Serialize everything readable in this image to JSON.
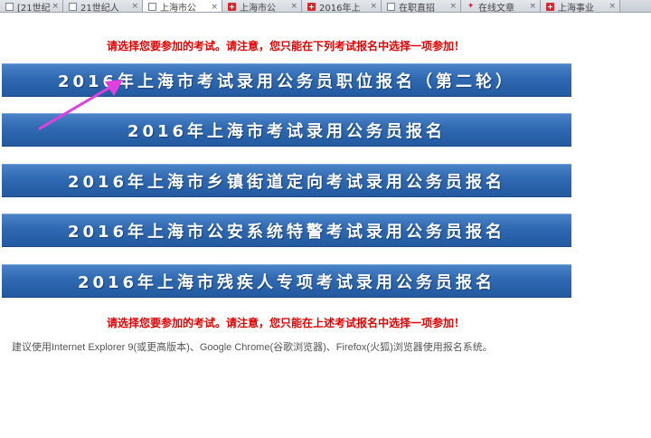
{
  "browser": {
    "tabs": [
      {
        "label": "[21世纪",
        "icon": "page-icon",
        "active": false
      },
      {
        "label": "21世纪人",
        "icon": "page-icon",
        "active": false
      },
      {
        "label": "上海市公",
        "icon": "page-icon",
        "active": true
      },
      {
        "label": "上海市公",
        "icon": "red-cross-icon",
        "active": false
      },
      {
        "label": "2016年上",
        "icon": "red-cross-icon",
        "active": false
      },
      {
        "label": "在职直招",
        "icon": "page-icon",
        "active": false
      },
      {
        "label": "在线文章",
        "icon": "star-icon",
        "active": false
      },
      {
        "label": "上海事业",
        "icon": "red-cross-icon",
        "active": false
      }
    ],
    "close_glyph": "×"
  },
  "page": {
    "notice_top": "请选择您要参加的考试。请注意，您只能在下列考试报名中选择一项参加！",
    "notice_bottom": "请选择您要参加的考试。请注意，您只能在上述考试报名中选择一项参加！",
    "exams": [
      "2016年上海市考试录用公务员职位报名（第二轮）",
      "2016年上海市考试录用公务员报名",
      "2016年上海市乡镇街道定向考试录用公务员报名",
      "2016年上海市公安系统特警考试录用公务员报名",
      "2016年上海市残疾人专项考试录用公务员报名"
    ],
    "browser_hint": "建议使用Internet Explorer 9(或更高版本)、Google Chrome(谷歌浏览器)、Firefox(火狐)浏览器使用报名系统。"
  },
  "colors": {
    "notice": "#e60000",
    "button": "#2f69b2",
    "arrow": "#e040e0"
  }
}
